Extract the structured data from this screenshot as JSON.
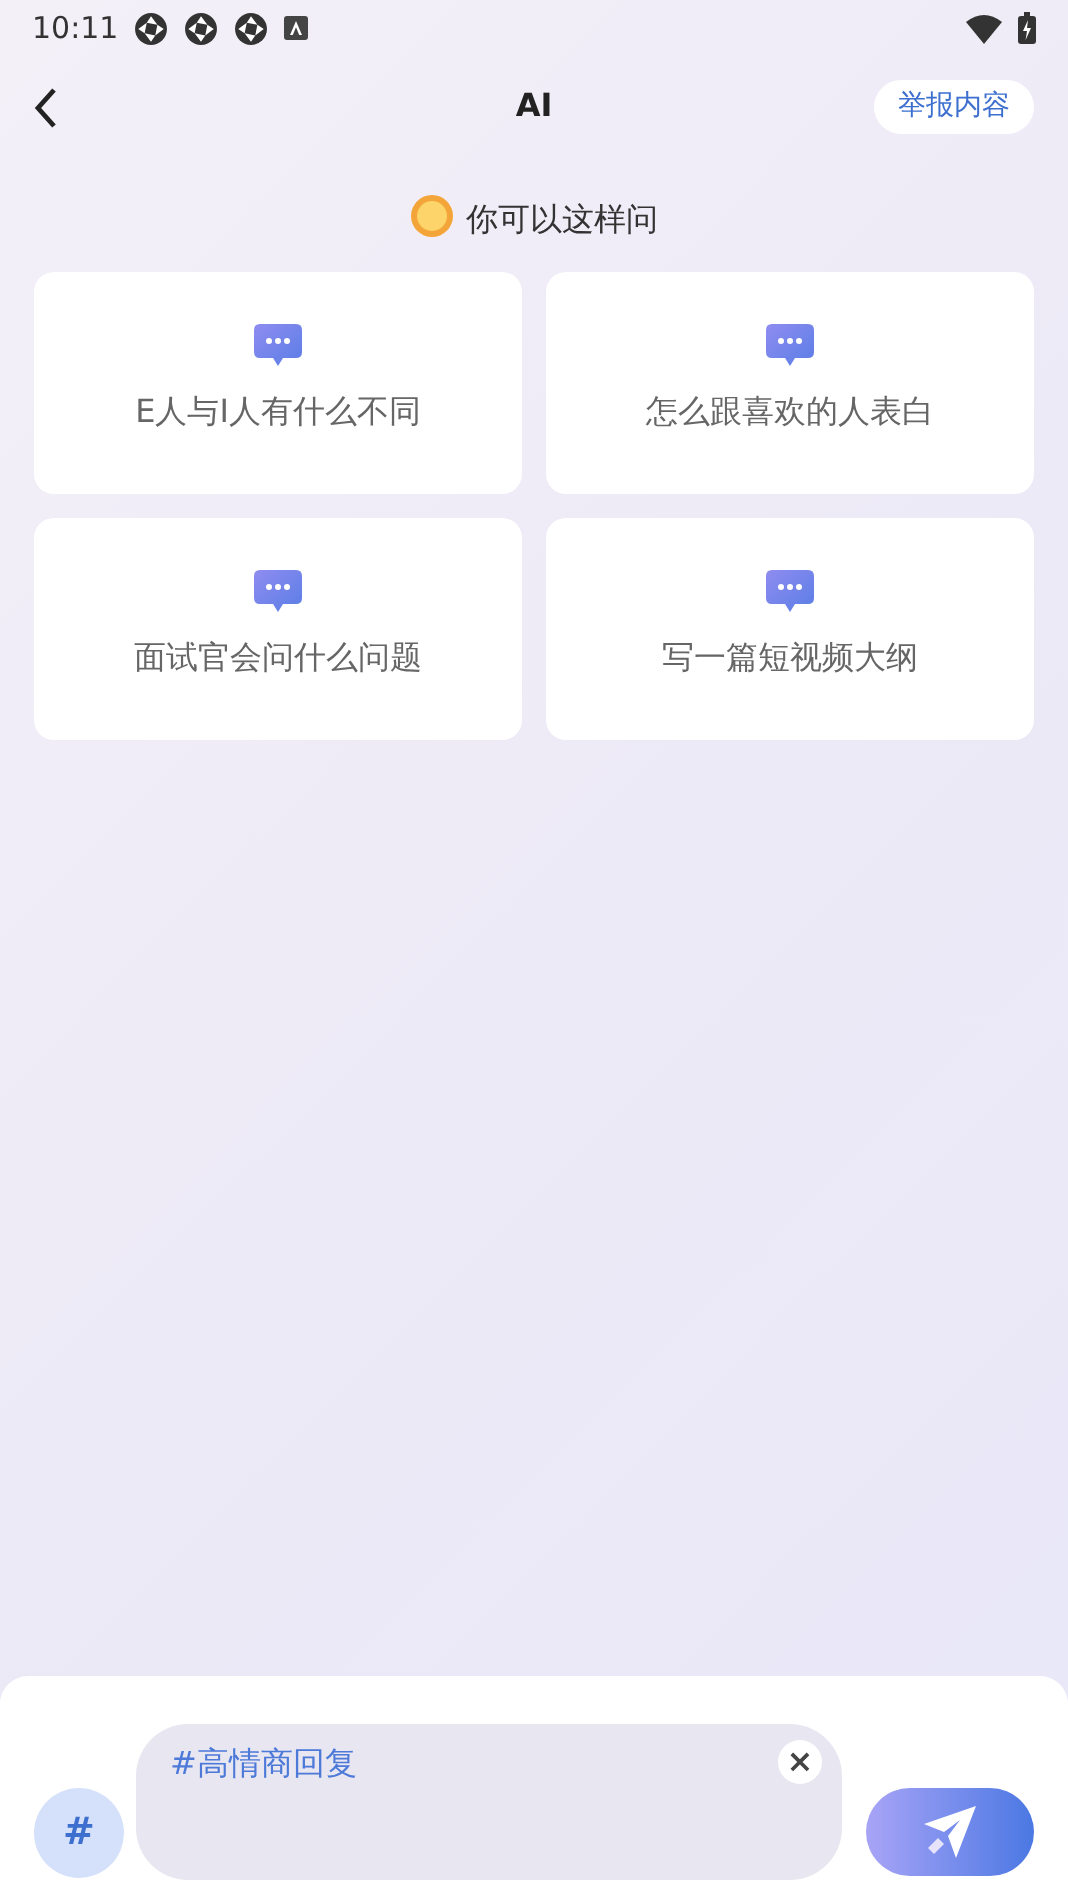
{
  "status_bar": {
    "time": "10:11"
  },
  "header": {
    "title": "AI",
    "report_button": "举报内容"
  },
  "suggestions": {
    "heading": "你可以这样问",
    "items": [
      {
        "text": "E人与I人有什么不同"
      },
      {
        "text": "怎么跟喜欢的人表白"
      },
      {
        "text": "面试官会问什么问题"
      },
      {
        "text": "写一篇短视频大纲"
      }
    ]
  },
  "composer": {
    "hash_button": "#",
    "topic_tag": "#高情商回复",
    "clear_button": "×"
  }
}
